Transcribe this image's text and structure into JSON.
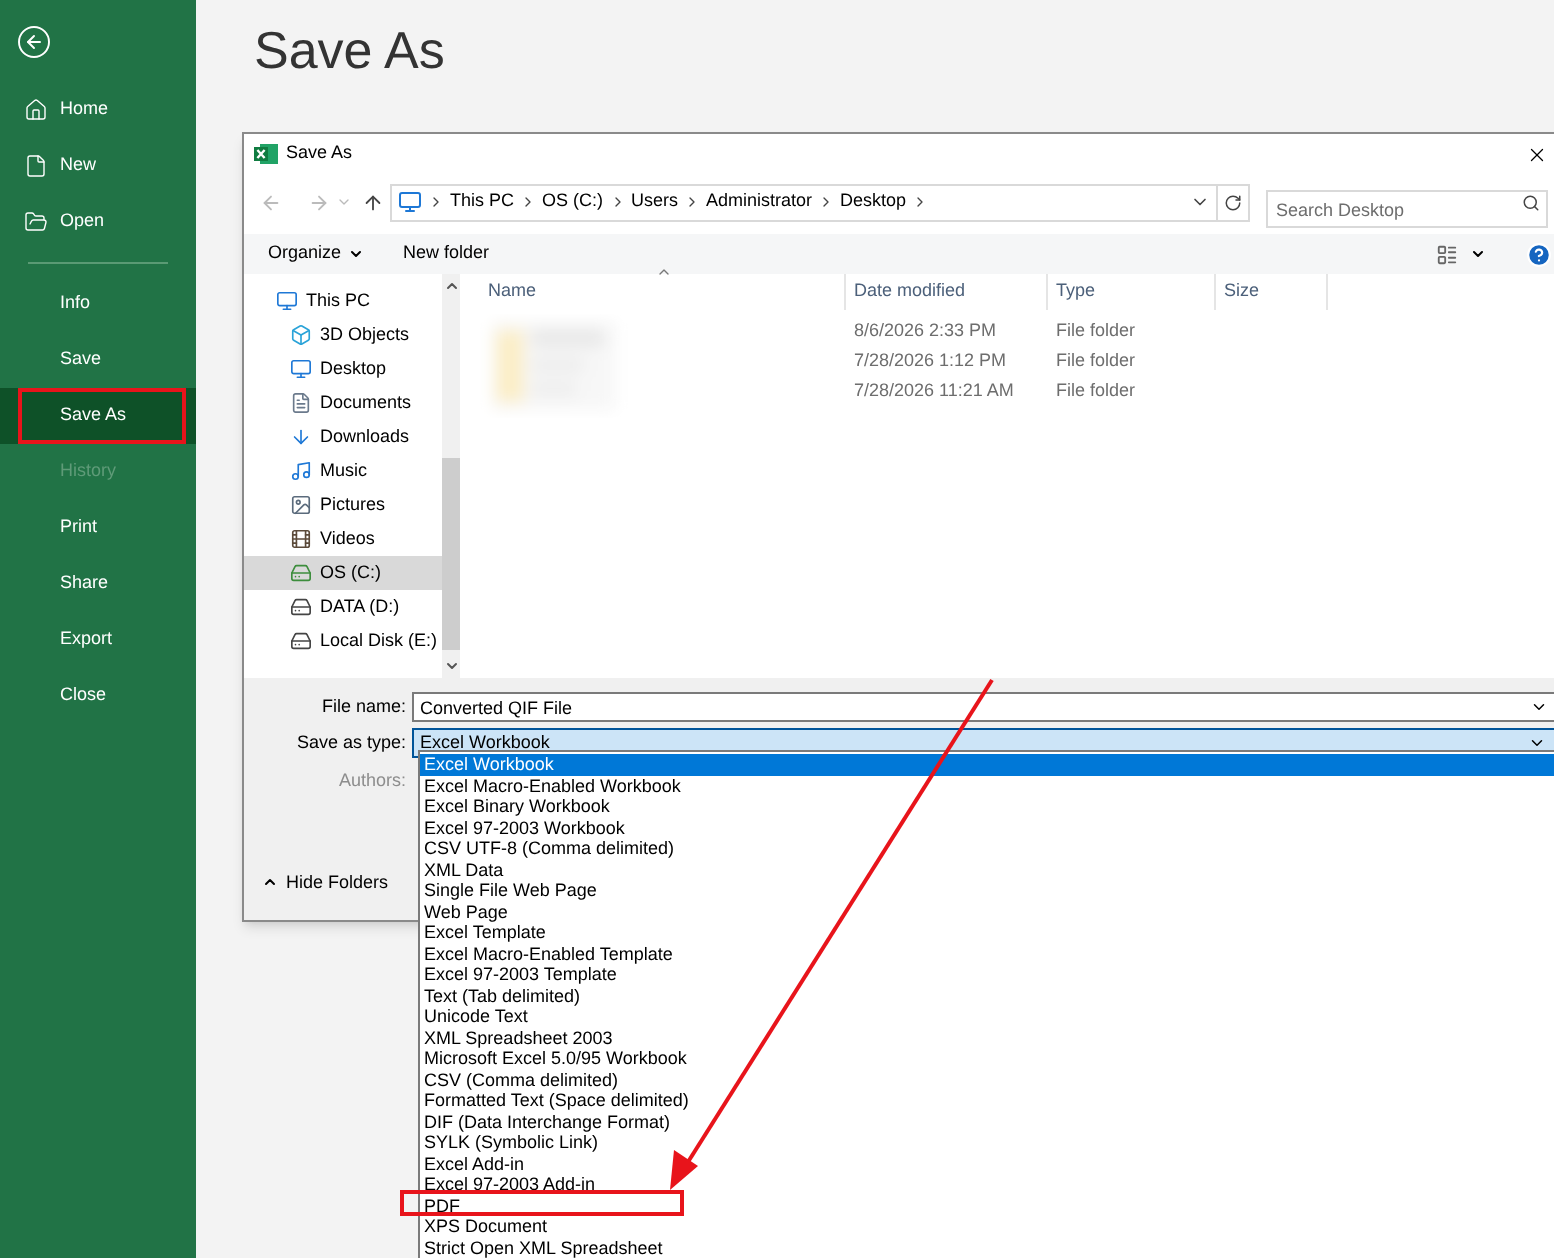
{
  "backstage": {
    "title": "Save As"
  },
  "sidebar": {
    "top_items": [
      {
        "label": "Home",
        "selected": false
      },
      {
        "label": "New",
        "selected": false
      },
      {
        "label": "Open",
        "selected": false
      }
    ],
    "items": [
      {
        "label": "Info",
        "selected": false,
        "disabled": false,
        "outlined": false
      },
      {
        "label": "Save",
        "selected": false,
        "disabled": false,
        "outlined": false
      },
      {
        "label": "Save As",
        "selected": true,
        "disabled": false,
        "outlined": true
      },
      {
        "label": "History",
        "selected": false,
        "disabled": true,
        "outlined": false
      },
      {
        "label": "Print",
        "selected": false,
        "disabled": false,
        "outlined": false
      },
      {
        "label": "Share",
        "selected": false,
        "disabled": false,
        "outlined": false
      },
      {
        "label": "Export",
        "selected": false,
        "disabled": false,
        "outlined": false
      },
      {
        "label": "Close",
        "selected": false,
        "disabled": false,
        "outlined": false
      }
    ]
  },
  "dialog": {
    "title": "Save As",
    "address": [
      "This PC",
      "OS (C:)",
      "Users",
      "Administrator",
      "Desktop"
    ],
    "search": {
      "placeholder": "Search Desktop"
    },
    "toolbar": {
      "organize": "Organize",
      "new_folder": "New folder"
    },
    "nav": [
      {
        "label": "This PC",
        "selected": false,
        "children": [
          {
            "label": "3D Objects",
            "selected": false
          },
          {
            "label": "Desktop",
            "selected": false
          },
          {
            "label": "Documents",
            "selected": false
          },
          {
            "label": "Downloads",
            "selected": false
          },
          {
            "label": "Music",
            "selected": false
          },
          {
            "label": "Pictures",
            "selected": false
          },
          {
            "label": "Videos",
            "selected": false
          },
          {
            "label": "OS (C:)",
            "selected": true
          },
          {
            "label": "DATA (D:)",
            "selected": false
          },
          {
            "label": "Local Disk (E:)",
            "selected": false
          }
        ]
      }
    ],
    "columns": [
      "Name",
      "Date modified",
      "Type",
      "Size"
    ],
    "rows": [
      {
        "date": "8/6/2026 2:33 PM",
        "type": "File folder"
      },
      {
        "date": "7/28/2026 1:12 PM",
        "type": "File folder"
      },
      {
        "date": "7/28/2026 11:21 AM",
        "type": "File folder"
      }
    ],
    "file_name": {
      "label": "File name:",
      "value": "Converted QIF File"
    },
    "save_as_type": {
      "label": "Save as type:",
      "value": "Excel Workbook",
      "expanded": true
    },
    "authors": {
      "label": "Authors:",
      "disabled": true
    },
    "hide_folders": "Hide Folders",
    "type_options": [
      {
        "label": "Excel Workbook",
        "selected": true,
        "outlined": false
      },
      {
        "label": "Excel Macro-Enabled Workbook",
        "selected": false,
        "outlined": false
      },
      {
        "label": "Excel Binary Workbook",
        "selected": false,
        "outlined": false
      },
      {
        "label": "Excel 97-2003 Workbook",
        "selected": false,
        "outlined": false
      },
      {
        "label": "CSV UTF-8 (Comma delimited)",
        "selected": false,
        "outlined": false
      },
      {
        "label": "XML Data",
        "selected": false,
        "outlined": false
      },
      {
        "label": "Single File Web Page",
        "selected": false,
        "outlined": false
      },
      {
        "label": "Web Page",
        "selected": false,
        "outlined": false
      },
      {
        "label": "Excel Template",
        "selected": false,
        "outlined": false
      },
      {
        "label": "Excel Macro-Enabled Template",
        "selected": false,
        "outlined": false
      },
      {
        "label": "Excel 97-2003 Template",
        "selected": false,
        "outlined": false
      },
      {
        "label": "Text (Tab delimited)",
        "selected": false,
        "outlined": false
      },
      {
        "label": "Unicode Text",
        "selected": false,
        "outlined": false
      },
      {
        "label": "XML Spreadsheet 2003",
        "selected": false,
        "outlined": false
      },
      {
        "label": "Microsoft Excel 5.0/95 Workbook",
        "selected": false,
        "outlined": false
      },
      {
        "label": "CSV (Comma delimited)",
        "selected": false,
        "outlined": false
      },
      {
        "label": "Formatted Text (Space delimited)",
        "selected": false,
        "outlined": false
      },
      {
        "label": "DIF (Data Interchange Format)",
        "selected": false,
        "outlined": false
      },
      {
        "label": "SYLK (Symbolic Link)",
        "selected": false,
        "outlined": false
      },
      {
        "label": "Excel Add-in",
        "selected": false,
        "outlined": false
      },
      {
        "label": "Excel 97-2003 Add-in",
        "selected": false,
        "outlined": false
      },
      {
        "label": "PDF",
        "selected": false,
        "outlined": true
      },
      {
        "label": "XPS Document",
        "selected": false,
        "outlined": false
      },
      {
        "label": "Strict Open XML Spreadsheet",
        "selected": false,
        "outlined": false
      }
    ]
  }
}
